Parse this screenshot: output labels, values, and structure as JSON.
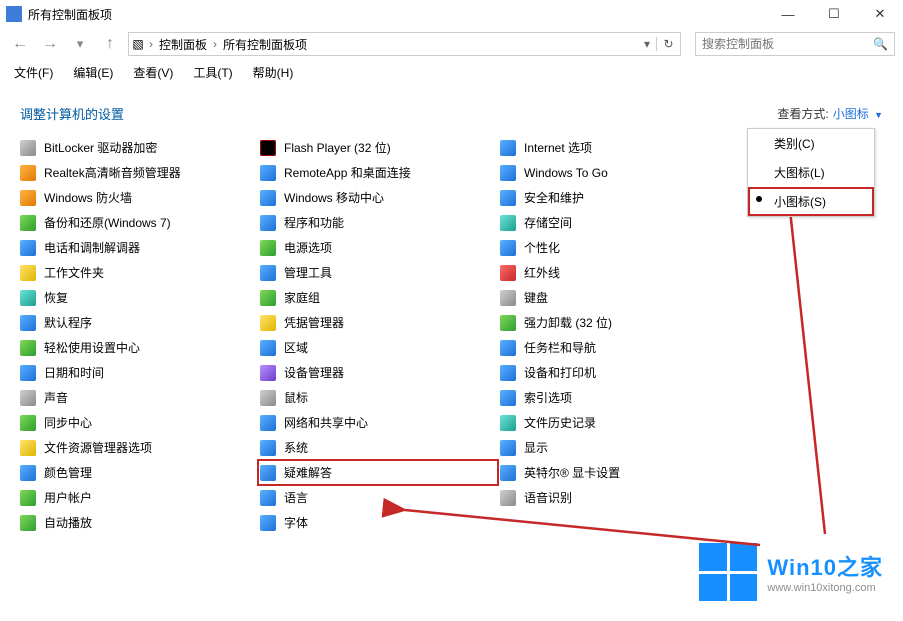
{
  "window": {
    "title": "所有控制面板项",
    "minimize": "—",
    "maximize": "☐",
    "close": "✕"
  },
  "nav": {
    "back": "←",
    "forward": "→",
    "up": "↑",
    "crumb1": "控制面板",
    "crumb2": "所有控制面板项",
    "seek": "▾",
    "refresh": "↻",
    "search_placeholder": "搜索控制面板",
    "mag": "🔍"
  },
  "menubar": [
    "文件(F)",
    "编辑(E)",
    "查看(V)",
    "工具(T)",
    "帮助(H)"
  ],
  "header": {
    "title": "调整计算机的设置",
    "viewby_label": "查看方式:",
    "viewby_value": "小图标"
  },
  "dropdown": {
    "items": [
      {
        "label": "类别(C)",
        "selected": false,
        "hl": false
      },
      {
        "label": "大图标(L)",
        "selected": false,
        "hl": false
      },
      {
        "label": "小图标(S)",
        "selected": true,
        "hl": true
      }
    ]
  },
  "items": [
    {
      "label": "BitLocker 驱动器加密",
      "ic": "i-gray"
    },
    {
      "label": "Flash Player (32 位)",
      "ic": "i-flash"
    },
    {
      "label": "Internet 选项",
      "ic": "i-blue"
    },
    {
      "label": "Realtek高清晰音频管理器",
      "ic": "i-orange"
    },
    {
      "label": "RemoteApp 和桌面连接",
      "ic": "i-blue"
    },
    {
      "label": "Windows To Go",
      "ic": "i-blue"
    },
    {
      "label": "Windows 防火墙",
      "ic": "i-orange"
    },
    {
      "label": "Windows 移动中心",
      "ic": "i-blue"
    },
    {
      "label": "安全和维护",
      "ic": "i-blue"
    },
    {
      "label": "备份和还原(Windows 7)",
      "ic": "i-green"
    },
    {
      "label": "程序和功能",
      "ic": "i-blue"
    },
    {
      "label": "存储空间",
      "ic": "i-teal"
    },
    {
      "label": "电话和调制解调器",
      "ic": "i-blue"
    },
    {
      "label": "电源选项",
      "ic": "i-green"
    },
    {
      "label": "个性化",
      "ic": "i-blue"
    },
    {
      "label": "工作文件夹",
      "ic": "i-yellow"
    },
    {
      "label": "管理工具",
      "ic": "i-blue"
    },
    {
      "label": "红外线",
      "ic": "i-red"
    },
    {
      "label": "恢复",
      "ic": "i-teal"
    },
    {
      "label": "家庭组",
      "ic": "i-green"
    },
    {
      "label": "键盘",
      "ic": "i-gray"
    },
    {
      "label": "默认程序",
      "ic": "i-blue"
    },
    {
      "label": "凭据管理器",
      "ic": "i-yellow"
    },
    {
      "label": "强力卸载 (32 位)",
      "ic": "i-green"
    },
    {
      "label": "轻松使用设置中心",
      "ic": "i-green"
    },
    {
      "label": "区域",
      "ic": "i-blue"
    },
    {
      "label": "任务栏和导航",
      "ic": "i-blue"
    },
    {
      "label": "日期和时间",
      "ic": "i-blue"
    },
    {
      "label": "设备管理器",
      "ic": "i-purple"
    },
    {
      "label": "设备和打印机",
      "ic": "i-blue"
    },
    {
      "label": "声音",
      "ic": "i-gray"
    },
    {
      "label": "鼠标",
      "ic": "i-gray"
    },
    {
      "label": "索引选项",
      "ic": "i-blue"
    },
    {
      "label": "同步中心",
      "ic": "i-green"
    },
    {
      "label": "网络和共享中心",
      "ic": "i-blue"
    },
    {
      "label": "文件历史记录",
      "ic": "i-teal"
    },
    {
      "label": "文件资源管理器选项",
      "ic": "i-yellow"
    },
    {
      "label": "系统",
      "ic": "i-blue"
    },
    {
      "label": "显示",
      "ic": "i-blue"
    },
    {
      "label": "颜色管理",
      "ic": "i-blue"
    },
    {
      "label": "疑难解答",
      "ic": "i-blue",
      "boxed": true
    },
    {
      "label": "英特尔® 显卡设置",
      "ic": "i-blue"
    },
    {
      "label": "用户帐户",
      "ic": "i-green"
    },
    {
      "label": "语言",
      "ic": "i-blue"
    },
    {
      "label": "语音识别",
      "ic": "i-gray"
    },
    {
      "label": "自动播放",
      "ic": "i-green"
    },
    {
      "label": "字体",
      "ic": "i-blue"
    }
  ],
  "watermark": {
    "big": "Win10之家",
    "small": "www.win10xitong.com"
  }
}
